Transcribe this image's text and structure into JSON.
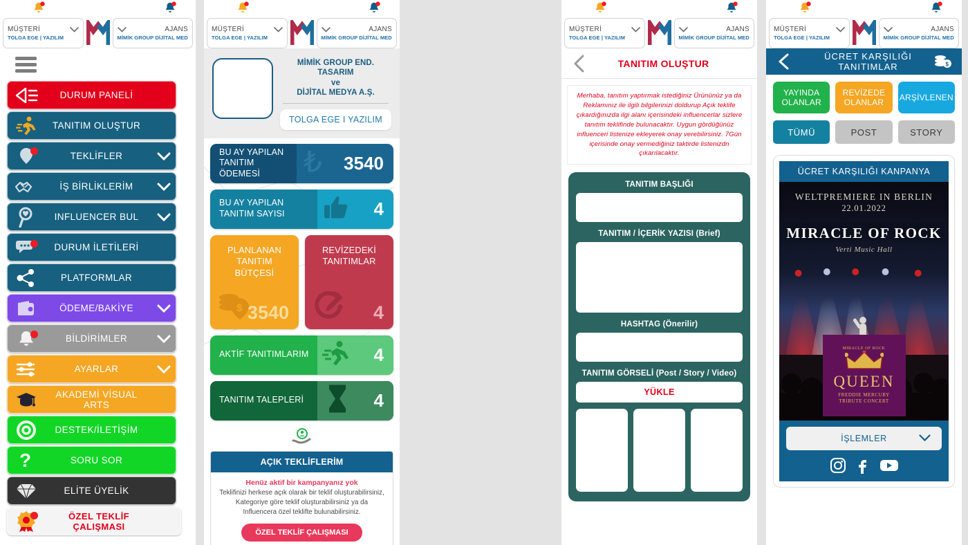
{
  "header": {
    "customer_label": "MÜŞTERİ",
    "customer_value": "TOLGA EGE | YAZILIM",
    "agency_label": "AJANS",
    "agency_value": "MİMİK GROUP DİJİTAL MEDYA",
    "logo": "mimik-m-logo",
    "bell_left_icon": "bell-icon",
    "bell_right_icon": "bell-icon"
  },
  "sidebar": {
    "menu_icon": "hamburger-icon",
    "items": [
      {
        "label": "DURUM PANELİ",
        "icon": "megaphone-icon",
        "color": "#e2001a",
        "chevron": false,
        "badge": false,
        "text_color": "#ffffff"
      },
      {
        "label": "TANITIM OLUŞTUR",
        "icon": "runner-icon",
        "color": "#17607f",
        "chevron": false,
        "badge": false,
        "text_color": "#ffffff"
      },
      {
        "label": "TEKLİFLER",
        "icon": "balloon-icon",
        "color": "#17607f",
        "chevron": true,
        "badge": true,
        "text_color": "#ffffff"
      },
      {
        "label": "İŞ BİRLİKLERİM",
        "icon": "handshake-icon",
        "color": "#17607f",
        "chevron": true,
        "badge": false,
        "text_color": "#ffffff"
      },
      {
        "label": "INFLUENCER  BUL",
        "icon": "search-heart-icon",
        "color": "#17607f",
        "chevron": true,
        "badge": false,
        "text_color": "#ffffff"
      },
      {
        "label": "DURUM İLETİLERİ",
        "icon": "chat-icon",
        "color": "#17607f",
        "chevron": false,
        "badge": true,
        "text_color": "#ffffff"
      },
      {
        "label": "PLATFORMLAR",
        "icon": "share-icon",
        "color": "#17607f",
        "chevron": false,
        "badge": false,
        "text_color": "#ffffff"
      },
      {
        "label": "ÖDEME/BAKİYE",
        "icon": "wallet-icon",
        "color": "#7d4ae8",
        "chevron": true,
        "badge": false,
        "text_color": "#ffffff"
      },
      {
        "label": "BİLDİRİMLER",
        "icon": "bell-icon",
        "color": "#9a9a9a",
        "chevron": true,
        "badge": true,
        "text_color": "#ffffff"
      },
      {
        "label": "AYARLAR",
        "icon": "sliders-icon",
        "color": "#f5a623",
        "chevron": true,
        "badge": false,
        "text_color": "#ffffff"
      },
      {
        "label": "AKADEMİ VİSUAL ARTS",
        "icon": "graduation-icon",
        "color": "#f5a623",
        "chevron": false,
        "badge": false,
        "text_color": "#ffffff"
      },
      {
        "label": "DESTEK/İLETİŞİM",
        "icon": "lifebuoy-icon",
        "color": "#12d626",
        "chevron": false,
        "badge": false,
        "text_color": "#ffffff"
      },
      {
        "label": "SORU SOR",
        "icon": "question-icon",
        "color": "#12d626",
        "chevron": false,
        "badge": false,
        "text_color": "#ffffff"
      },
      {
        "label": "ELİTE ÜYELİK",
        "icon": "diamond-icon",
        "color": "#333333",
        "chevron": false,
        "badge": false,
        "text_color": "#ffffff"
      },
      {
        "label": "ÖZEL TEKLİF ÇALIŞMASI",
        "icon": "award-icon",
        "color": "#f4f4f4",
        "chevron": false,
        "badge": true,
        "text_color": "#e2001a"
      }
    ]
  },
  "dashboard": {
    "brand_title": "MİMİK GROUP END. TASARIM\nve\nDİJİTAL MEDYA A.Ş.",
    "brand_title_line1": "MİMİK GROUP END. TASARIM",
    "brand_title_line2": "ve",
    "brand_title_line3": "DİJİTAL MEDYA A.Ş.",
    "brand_button": "TOLGA EGE I YAZILIM",
    "brand_image": "company-logo-placeholder",
    "stats": [
      {
        "label_line1": "BU AY YAPILAN",
        "label_line2": "TANITIM ÖDEMESİ",
        "value": "3540",
        "icon": "lira-icon",
        "color": "#134f74",
        "accent": "#1b6691"
      },
      {
        "label_line1": "BU AY YAPILAN",
        "label_line2": "TANITIM SAYISI",
        "value": "4",
        "icon": "thumbs-up-icon",
        "color": "#1581a0",
        "accent": "#17a1c4"
      },
      {
        "label_line1": "PLANLANAN",
        "label_line2": "TANITIM BÜTÇESİ",
        "value": "3540",
        "icon": "coins-icon",
        "color": "#f5a623",
        "accent": "#f8be5a"
      },
      {
        "label_line1": "REVİZEDEKİ",
        "label_line2": "TANITIMLAR",
        "value": "4",
        "icon": "revision-icon",
        "color": "#c03a4e",
        "accent": "#d2687a"
      },
      {
        "label_line1": "AKTİF TANITIMLARIM",
        "label_line2": "",
        "value": "4",
        "icon": "runner-icon",
        "color": "#21b24b",
        "accent": "#5cc97c"
      },
      {
        "label_line1": "TANITIM TALEPLERİ",
        "label_line2": "",
        "value": "4",
        "icon": "hourglass-icon",
        "color": "#11673a",
        "accent": "#3c8a5e"
      }
    ],
    "hand_icon": "hand-user-icon",
    "offers": {
      "title": "AÇIK TEKLİFLERİM",
      "alert": "Henüz aktif bir kampanyanız yok",
      "body_line1": "Teklifinizi herkese açık olarak bir teklif oluşturabilirsiniz,",
      "body_line2": "Kategoriye göre teklif oluşturabilirsiniz ya da",
      "body_line3": "Influencera özel teklifte bulunabilirsiniz.",
      "cta": "ÖZEL TEKLİF ÇALIŞMASI"
    }
  },
  "create_promo": {
    "back_icon": "chevron-left-icon",
    "title": "TANITIM OLUŞTUR",
    "notice": "Merhaba, tanıtım yaptırmak istediğiniz Ürününüz ya da Reklamınız ile ilgili bilgilerinizi  doldurup Açık teklife çıkardığınızda ilgi alanı içerisindeki influencerlar sizlere tanıtım teklifinde bulunacaktır. Uygun gördüğünüz influenceri listenize ekleyerek onay verebilirsiniz. 7Gün içerisinde  onay vermediğiniz taktirde listenizdn çıkarılacaktır.",
    "fields": [
      {
        "label": "TANITIM BAŞLIĞI",
        "type": "input",
        "value": ""
      },
      {
        "label": "TANITIM  / İÇERİK YAZISI (Brief)",
        "type": "textarea",
        "value": ""
      },
      {
        "label": "HASHTAG (Önerilir)",
        "type": "input",
        "value": ""
      },
      {
        "label": "TANITIM GÖRSELİ (Post / Story / Video)",
        "type": "upload",
        "value": ""
      }
    ],
    "upload_button": "YÜKLE",
    "thumb_count": 3
  },
  "paid_promos": {
    "back_icon": "chevron-left-icon",
    "title": "ÜCRET KARŞILIĞI  TANITIMLAR",
    "title_icon": "coins-money-icon",
    "status_filters": [
      {
        "label_line1": "YAYINDA",
        "label_line2": "OLANLAR",
        "color": "#21b24b"
      },
      {
        "label_line1": "REVİZEDE",
        "label_line2": "OLANLAR",
        "color": "#f5a623"
      },
      {
        "label_line1": "ARŞİVLENEN",
        "label_line2": "",
        "color": "#17a8e0"
      }
    ],
    "type_filters": [
      {
        "label": "TÜMÜ",
        "color": "#1581a0",
        "text_color": "#ffffff",
        "active": true
      },
      {
        "label": "POST",
        "color": "#c4c4c4",
        "text_color": "#3a3a3a",
        "active": false
      },
      {
        "label": "STORY",
        "color": "#c4c4c4",
        "text_color": "#3a3a3a",
        "active": false
      }
    ],
    "campaign": {
      "badge": "ÜCRET  KARŞILIĞI  KANPANYA",
      "poster_line1": "WELTPREMIERE IN BERLIN",
      "poster_line2": "22.01.2022",
      "poster_title": "MIRACLE OF ROCK",
      "poster_venue": "Verti Music Hall",
      "overlay_small": "MIRACLE OF ROCK",
      "overlay_title": "QUEEN",
      "overlay_sub_line1": "FREDDIE MERCURY",
      "overlay_sub_line2": "TRIBUTE CONCERT",
      "actions_label": "İŞLEMLER",
      "actions_chevron": "chevron-down-icon",
      "socials": [
        "instagram-icon",
        "facebook-icon",
        "youtube-icon"
      ]
    }
  }
}
